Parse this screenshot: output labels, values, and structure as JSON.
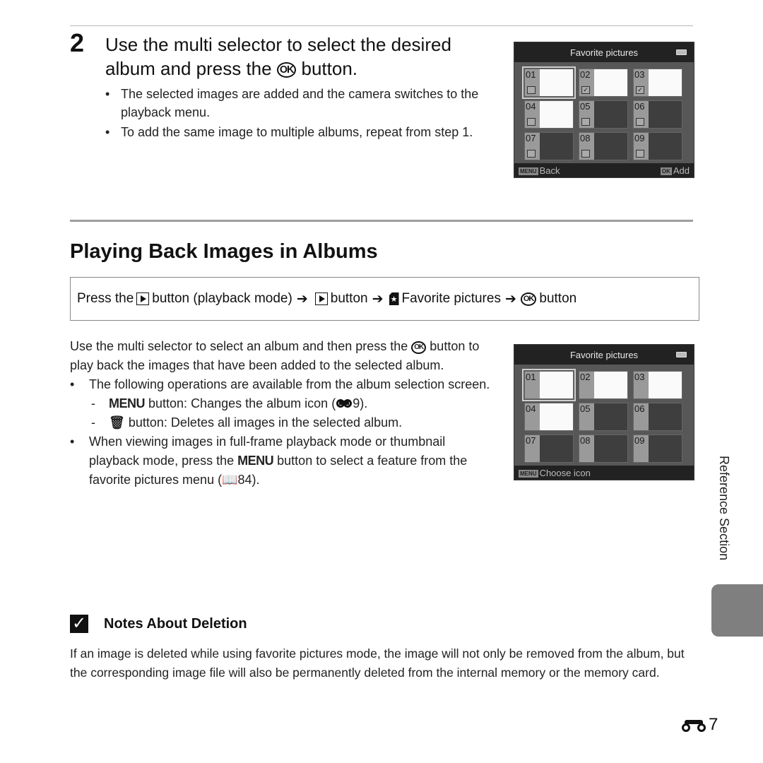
{
  "step": {
    "number": "2",
    "title_part1": "Use the multi selector to select the desired album and press the",
    "ok_label": "OK",
    "title_part2": "button.",
    "bullets": [
      "The selected images are added and the camera switches to the playback menu.",
      "To add the same image to multiple albums, repeat from step 1."
    ]
  },
  "screen1": {
    "header": "Favorite pictures",
    "albums": [
      {
        "label": "01",
        "checked": false,
        "has_image": true,
        "selected": true
      },
      {
        "label": "02",
        "checked": true,
        "has_image": true,
        "selected": false
      },
      {
        "label": "03",
        "checked": true,
        "has_image": true,
        "selected": false
      },
      {
        "label": "04",
        "checked": false,
        "has_image": true,
        "selected": false
      },
      {
        "label": "05",
        "checked": false,
        "has_image": false,
        "selected": false
      },
      {
        "label": "06",
        "checked": false,
        "has_image": false,
        "selected": false
      },
      {
        "label": "07",
        "checked": false,
        "has_image": false,
        "selected": false
      },
      {
        "label": "08",
        "checked": false,
        "has_image": false,
        "selected": false
      },
      {
        "label": "09",
        "checked": false,
        "has_image": false,
        "selected": false
      }
    ],
    "footer_left_key": "MENU",
    "footer_left": "Back",
    "footer_right_key": "OK",
    "footer_right": "Add"
  },
  "section": {
    "title": "Playing Back Images in Albums",
    "path": {
      "press_the": "Press the",
      "step1": "button (playback mode)",
      "step2": "button",
      "step3": "Favorite pictures",
      "step4": "button",
      "arrow": "➔"
    }
  },
  "body": {
    "intro_part1": "Use the multi selector to select an album and then press the",
    "intro_ok": "OK",
    "intro_part2": "button to play back the images that have been added to the selected album.",
    "bullet1": "The following operations are available from the album selection screen.",
    "dash1_key": "MENU",
    "dash1_text": "button: Changes the album icon (",
    "dash1_ref": "9).",
    "dash2_text": "button: Deletes all images in the selected album.",
    "bullet2_part1": "When viewing images in full-frame playback mode or thumbnail playback mode, press the",
    "bullet2_key": "MENU",
    "bullet2_part2": "button to select a feature from the favorite pictures menu (",
    "bullet2_ref": "84)."
  },
  "screen2": {
    "header": "Favorite pictures",
    "albums": [
      {
        "label": "01",
        "has_image": true,
        "selected": true
      },
      {
        "label": "02",
        "has_image": true,
        "selected": false
      },
      {
        "label": "03",
        "has_image": true,
        "selected": false
      },
      {
        "label": "04",
        "has_image": true,
        "selected": false
      },
      {
        "label": "05",
        "has_image": false,
        "selected": false
      },
      {
        "label": "06",
        "has_image": false,
        "selected": false
      },
      {
        "label": "07",
        "has_image": false,
        "selected": false
      },
      {
        "label": "08",
        "has_image": false,
        "selected": false
      },
      {
        "label": "09",
        "has_image": false,
        "selected": false
      }
    ],
    "footer_left_key": "MENU",
    "footer_left": "Choose icon"
  },
  "side": {
    "label": "Reference Section"
  },
  "note": {
    "title": "Notes About Deletion",
    "body": "If an image is deleted while using favorite pictures mode, the image will not only be removed from the album, but the corresponding image file will also be permanently deleted from the internal memory or the memory card."
  },
  "page": {
    "number": "7"
  }
}
